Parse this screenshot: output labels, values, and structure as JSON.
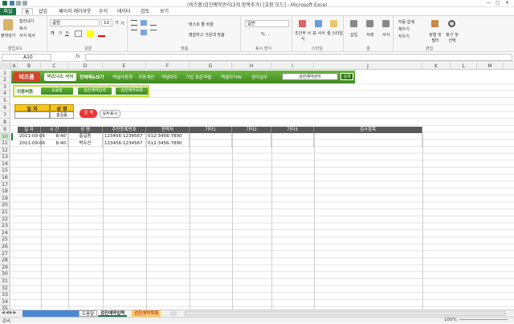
{
  "window": {
    "title": "(비즈폼)검진예약관리(3개 항목추가) [호환 모드] - Microsoft Excel",
    "controls": [
      "—",
      "▢",
      "✕"
    ]
  },
  "ribbon_tabs": [
    "파일",
    "홈",
    "삽입",
    "페이지 레이아웃",
    "수식",
    "데이터",
    "검토",
    "보기"
  ],
  "ribbon": {
    "clipboard": {
      "paste": "붙여넣기",
      "cut": "잘라내기",
      "copy": "복사",
      "format": "서식 복사",
      "label": "클립보드"
    },
    "font": {
      "name": "굴림",
      "size": "10",
      "label": "글꼴",
      "grow": "가",
      "shrink": "가",
      "bold": "가",
      "italic": "가",
      "underline": "가"
    },
    "align": {
      "wrap": "텍스트 줄 바꿈",
      "merge": "병합하고 가운데 맞춤",
      "label": "맞춤"
    },
    "number": {
      "format": "일반",
      "pct": "%",
      "comma": ",",
      "label": "표시 형식"
    },
    "styles": {
      "cond": "조건부 서식",
      "table": "표 서식",
      "cell": "셀 스타일",
      "label": "스타일"
    },
    "cells": {
      "insert": "삽입",
      "delete": "삭제",
      "format": "서식",
      "label": "셀"
    },
    "editing": {
      "sum": "자동 합계",
      "fill": "채우기",
      "clear": "지우기",
      "sort": "정렬 및 필터",
      "find": "찾기 및 선택",
      "label": "편집"
    }
  },
  "formula": {
    "name_box": "A10",
    "fx": "fx",
    "value": ""
  },
  "columns": [
    "A",
    "B",
    "C",
    "D",
    "E",
    "F",
    "G",
    "H",
    "I",
    "J",
    "K",
    "L",
    "M"
  ],
  "rows": [
    "1",
    "2",
    "3",
    "4",
    "5",
    "6",
    "7",
    "8",
    "9",
    "10",
    "11",
    "12",
    "13",
    "14",
    "15",
    "16",
    "17",
    "18",
    "19",
    "20",
    "21",
    "22",
    "23",
    "24",
    "25",
    "26",
    "27",
    "28",
    "29",
    "30",
    "31",
    "32",
    "33",
    "34",
    "35",
    "36",
    "37",
    "38",
    "39",
    "40",
    "41",
    "42",
    "43",
    "44"
  ],
  "banner": {
    "logo": "비즈폼",
    "sub": "비즈니스 서식",
    "menu": [
      "전체메뉴보기",
      "엑셀자동화",
      "자동계산",
      "엑셀차트",
      "기업 표준엑셀",
      "엑셀자식iN",
      "경리실무"
    ],
    "search_value": "검진예약관리",
    "search_btn": "검색"
  },
  "nav": {
    "label": "이동버튼",
    "buttons": [
      "도움말",
      "검진예약입력",
      "검진예약목록"
    ]
  },
  "filter": {
    "date_label": "일 자",
    "name_label": "성 명",
    "date_value": "",
    "name_value": "홍길동",
    "search_btn": "검 색",
    "all_btn": "모두표시"
  },
  "table": {
    "headers": [
      "일 자",
      "시 간",
      "성 명",
      "주민등록번호",
      "연락처",
      "기타1",
      "기타2",
      "기타3",
      "검사항목"
    ],
    "rows": [
      [
        "2011-09-06",
        "8:40",
        "홍길동",
        "123456-1234567",
        "012-3456-7890",
        "",
        "",
        "",
        ""
      ],
      [
        "2011-09-06",
        "8:40",
        "박두산",
        "123456-1234567",
        "012-3456-7890",
        "",
        "",
        "",
        ""
      ]
    ]
  },
  "sheets": [
    "도움말",
    "검진예약입력",
    "검진예약목록"
  ],
  "status": {
    "ready": "준비",
    "zoom": "100%"
  },
  "colors": {
    "green": "#3f8a1e",
    "excel": "#217346",
    "yellow": "#f5c518",
    "header": "#595959"
  }
}
